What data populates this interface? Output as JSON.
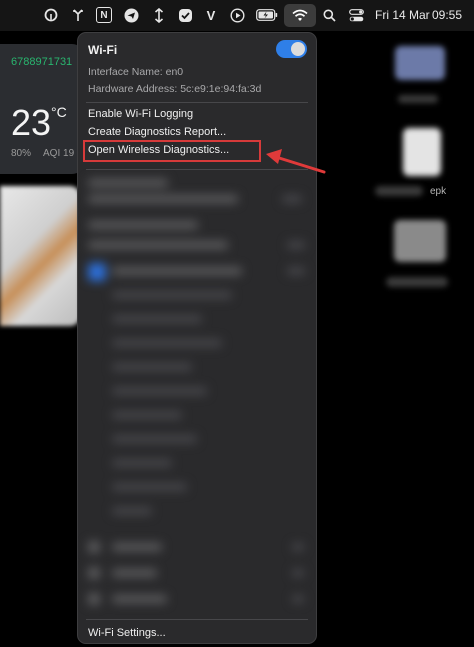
{
  "menubar": {
    "icons": [
      "app-logo-icon",
      "fork-icon",
      "notion-icon",
      "send-icon",
      "arrows-vertical-icon",
      "check-badge-icon",
      "vpn-icon",
      "play-icon",
      "battery-charging-icon",
      "wifi-icon",
      "search-icon",
      "control-center-icon"
    ],
    "notion_glyph": "N",
    "vpn_glyph": "V",
    "date": "Fri 14 Mar",
    "time": "09:55"
  },
  "weather": {
    "number": "6788971731",
    "temperature": "23",
    "unit": "°C",
    "humidity": "80%",
    "aqi": "AQI 19"
  },
  "desktop": {
    "label_fragment": "epk"
  },
  "wifi_menu": {
    "title": "Wi-Fi",
    "toggle_on": true,
    "interface_name": "Interface Name: en0",
    "hardware_address": "Hardware Address: 5c:e9:1e:94:fa:3d",
    "items": [
      "Enable Wi-Fi Logging",
      "Create Diagnostics Report...",
      "Open Wireless Diagnostics..."
    ],
    "settings": "Wi-Fi Settings...",
    "accent_color": "#2f7fe8"
  },
  "annotation": {
    "highlight_color": "#d63a3a"
  }
}
